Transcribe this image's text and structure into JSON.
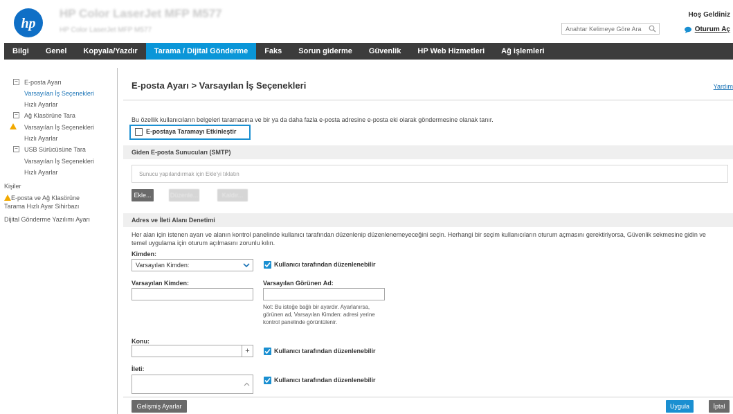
{
  "header": {
    "product_title": "HP Color LaserJet MFP M577",
    "product_subtitle": "HP Color LaserJet MFP M577",
    "search_placeholder": "Anahtar Kelimeye Göre Ara",
    "welcome": "Hoş Geldiniz",
    "sign_in": "Oturum Aç"
  },
  "nav": {
    "items": [
      "Bilgi",
      "Genel",
      "Kopyala/Yazdır",
      "Tarama / Dijital Gönderme",
      "Faks",
      "Sorun giderme",
      "Güvenlik",
      "HP Web Hizmetleri",
      "Ağ işlemleri"
    ],
    "active_index": 3
  },
  "sidebar": {
    "items": [
      "E-posta Ayarı",
      "Varsayılan İş Seçenekleri",
      "Hızlı Ayarlar",
      "Ağ Klasörüne Tara",
      "Varsayılan İş Seçenekleri",
      "Hızlı Ayarlar",
      "USB Sürücüsüne Tara",
      "Varsayılan İş Seçenekleri",
      "Hızlı Ayarlar",
      "Kişiler",
      "E-posta ve Ağ Klasörüne",
      "Tarama Hızlı Ayar Sihirbazı",
      "Dijital Gönderme Yazılımı Ayarı"
    ],
    "tree_toggle": "−",
    "warning_mark": "!"
  },
  "main": {
    "title": "E-posta Ayarı > Varsayılan İş Seçenekleri",
    "help": "Yardım",
    "description": "Bu özellik kullanıcıların belgeleri taramasına ve bir ya da daha fazla e-posta adresine e-posta eki olarak göndermesine olanak tanır.",
    "enable_label": "E-postaya Taramayı Etkinleştir",
    "smtp_header": "Giden E-posta Sunucuları (SMTP)",
    "server_placeholder": "Sunucu yapılandırmak için Ekle'yi tıklatın",
    "add_button": "Ekle...",
    "edit_button": "Düzenle...",
    "remove_button": "Kaldır...",
    "address_header": "Adres ve İleti Alanı Denetimi",
    "address_desc_1": "Her alan için istenen ayarı ve alanın kontrol panelinde kullanıcı tarafından düzenlenip düzenlenemeyeceğini seçin. Herhangi bir seçim kullanıcıların oturum açmasını gerektiriyorsa, Güvenlik sekmesine gidin ve",
    "address_desc_2": "temel uygulama için oturum açılmasını zorunlu kılın.",
    "from_label": "Kimden:",
    "from_value": "Varsayılan Kimden:",
    "editable_label": "Kullanıcı tarafından düzenlenebilir",
    "default_from_label": "Varsayılan Kimden:",
    "display_name_label": "Varsayılan Görünen Ad:",
    "note": "Not: Bu isteğe bağlı bir ayardır. Ayarlanırsa, görünen ad, Varsayılan Kimden: adresi yerine kontrol panelinde görüntülenir.",
    "subject_label": "Konu:",
    "message_label": "İleti:",
    "plus": "+",
    "advanced_button": "Gelişmiş Ayarlar",
    "apply_button": "Uygula",
    "cancel_button": "İptal"
  }
}
